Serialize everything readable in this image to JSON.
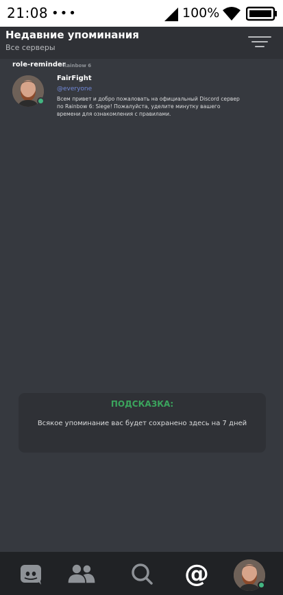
{
  "status_bar": {
    "time": "21:08",
    "dots": "•••",
    "battery_percent": "100%",
    "icons": [
      "signal-icon",
      "wifi-icon",
      "battery-icon"
    ]
  },
  "header": {
    "title": "Недавние упоминания",
    "subtitle": "Все серверы",
    "filter_icon": "filter-icon"
  },
  "mentions": [
    {
      "channel": "role-reminder",
      "server": "Rainbow 6",
      "author": "FairFight",
      "tag": "@everyone",
      "text": "Всем привет и добро пожаловать на официальный Discord сервер по Rainbow 6: Siege! Пожалуйста, уделите минутку вашего времени для ознакомления с правилами.",
      "status": "online"
    }
  ],
  "tip": {
    "title": "ПОДСКАЗКА:",
    "text": "Всякое упоминание вас будет сохранено здесь на 7 дней"
  },
  "bottom_nav": {
    "items": [
      "discord-home-icon",
      "friends-icon",
      "search-icon",
      "mentions-icon",
      "profile-avatar"
    ],
    "active": "mentions-icon"
  },
  "colors": {
    "background": "#36393f",
    "header": "#2f3136",
    "nav": "#202225",
    "accent_green": "#3ba55d",
    "mention_blue": "#7289da",
    "online": "#43b581"
  }
}
